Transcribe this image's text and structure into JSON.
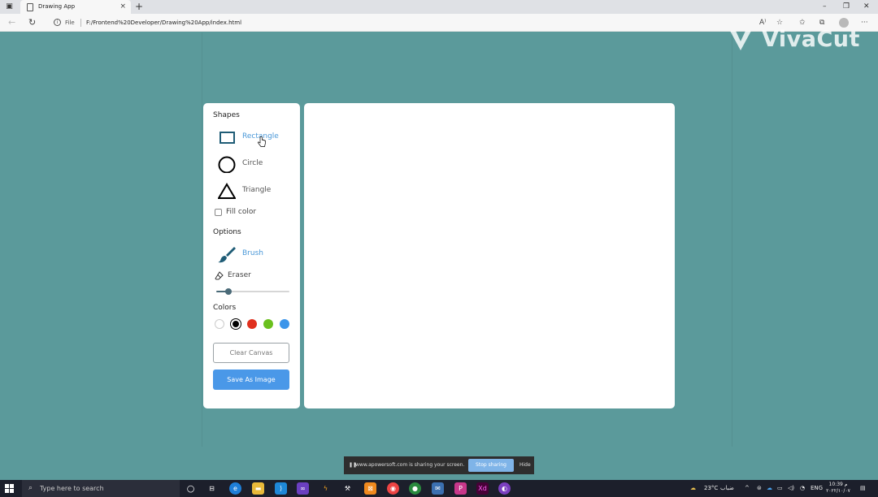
{
  "browser": {
    "tab_title": "Drawing App",
    "tab_close": "×",
    "new_tab": "+",
    "window_controls": [
      "–",
      "❐",
      "✕"
    ],
    "nav": {
      "back": "←",
      "refresh": "↻"
    },
    "file_label": "File",
    "url": "F:/Frontend%20Developer/Drawing%20App/index.html",
    "toolbar_icons": [
      "read-aloud-icon",
      "add-favorite-icon",
      "favorites-icon",
      "collections-icon",
      "profile-icon",
      "more-icon"
    ],
    "more": "···"
  },
  "watermark": {
    "text": "VivaCut"
  },
  "tools": {
    "shapes_title": "Shapes",
    "shapes": [
      {
        "label": "Rectangle",
        "icon": "rectangle-icon",
        "active": true
      },
      {
        "label": "Circle",
        "icon": "circle-icon",
        "active": false
      },
      {
        "label": "Triangle",
        "icon": "triangle-icon",
        "active": false
      }
    ],
    "fill_color_label": "Fill color",
    "fill_color_checked": false,
    "options_title": "Options",
    "brush_label": "Brush",
    "eraser_label": "Eraser",
    "brush_size_fraction": 0.17,
    "colors_title": "Colors",
    "colors": [
      "#ffffff",
      "#000000",
      "#e0301e",
      "#6ac01e",
      "#3b95ea"
    ],
    "selected_color_index": 1,
    "clear_label": "Clear Canvas",
    "save_label": "Save As Image"
  },
  "sharing_bar": {
    "message": "www.apowersoft.com is sharing your screen.",
    "stop_label": "Stop sharing",
    "hide_label": "Hide"
  },
  "taskbar": {
    "search_placeholder": "Type here to search",
    "weather": "23°C",
    "weather_text": "ضباب",
    "language": "ENG",
    "time": "10:39 م",
    "date": "٢٠٢٢/١٠/٠٧"
  }
}
